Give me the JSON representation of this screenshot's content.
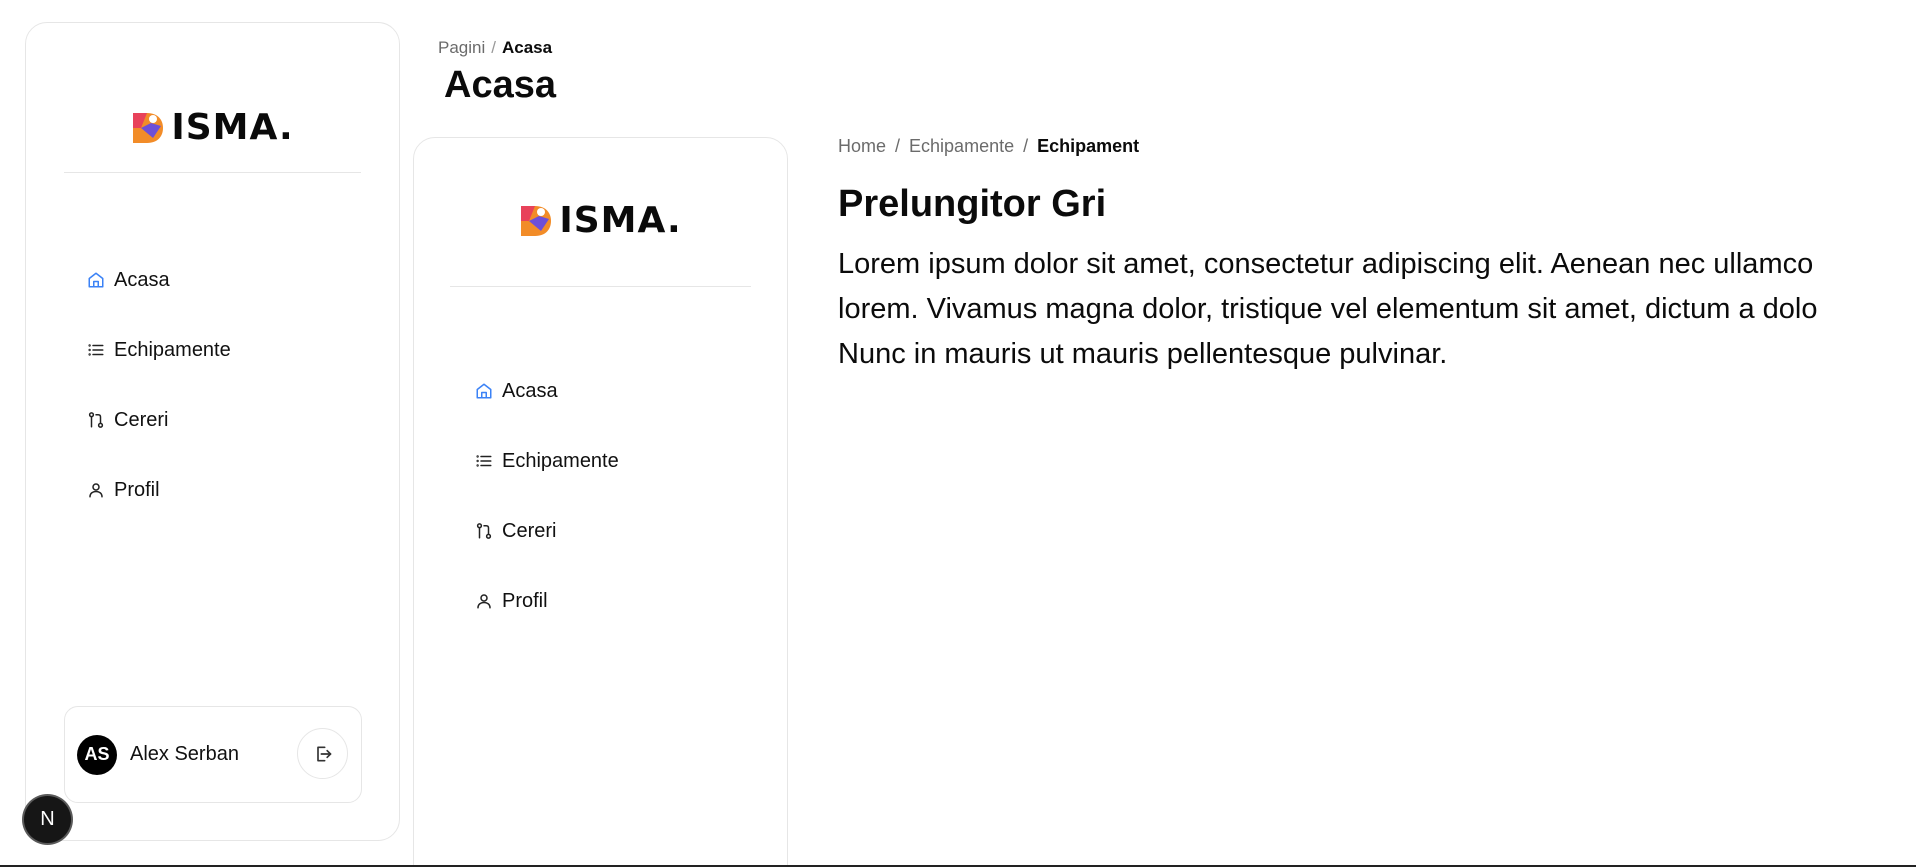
{
  "brand": {
    "name": "ISMA.",
    "accent_colors": [
      "#f28c28",
      "#e8425a",
      "#6d4fd8"
    ]
  },
  "sidebar": {
    "items": [
      {
        "label": "Acasa",
        "icon": "home-icon",
        "active": true
      },
      {
        "label": "Echipamente",
        "icon": "list-icon",
        "active": false
      },
      {
        "label": "Cereri",
        "icon": "git-pull-icon",
        "active": false
      },
      {
        "label": "Profil",
        "icon": "user-icon",
        "active": false
      }
    ],
    "user": {
      "initials": "AS",
      "name": "Alex Serban"
    },
    "logout_icon": "logout-icon"
  },
  "header": {
    "breadcrumb_root": "Pagini",
    "breadcrumb_sep": "/",
    "breadcrumb_current": "Acasa",
    "title": "Acasa"
  },
  "content": {
    "breadcrumbs": [
      "Home",
      "Echipamente",
      "Echipament"
    ],
    "crumb_sep": "/",
    "title": "Prelungitor Gri",
    "description": [
      "Lorem ipsum dolor sit amet, consectetur adipiscing elit. Aenean nec ullamco",
      "lorem. Vivamus magna dolor, tristique vel elementum sit amet, dictum a dolo",
      "Nunc in mauris ut mauris pellentesque pulvinar."
    ]
  },
  "dev_badge": {
    "label": "N"
  }
}
